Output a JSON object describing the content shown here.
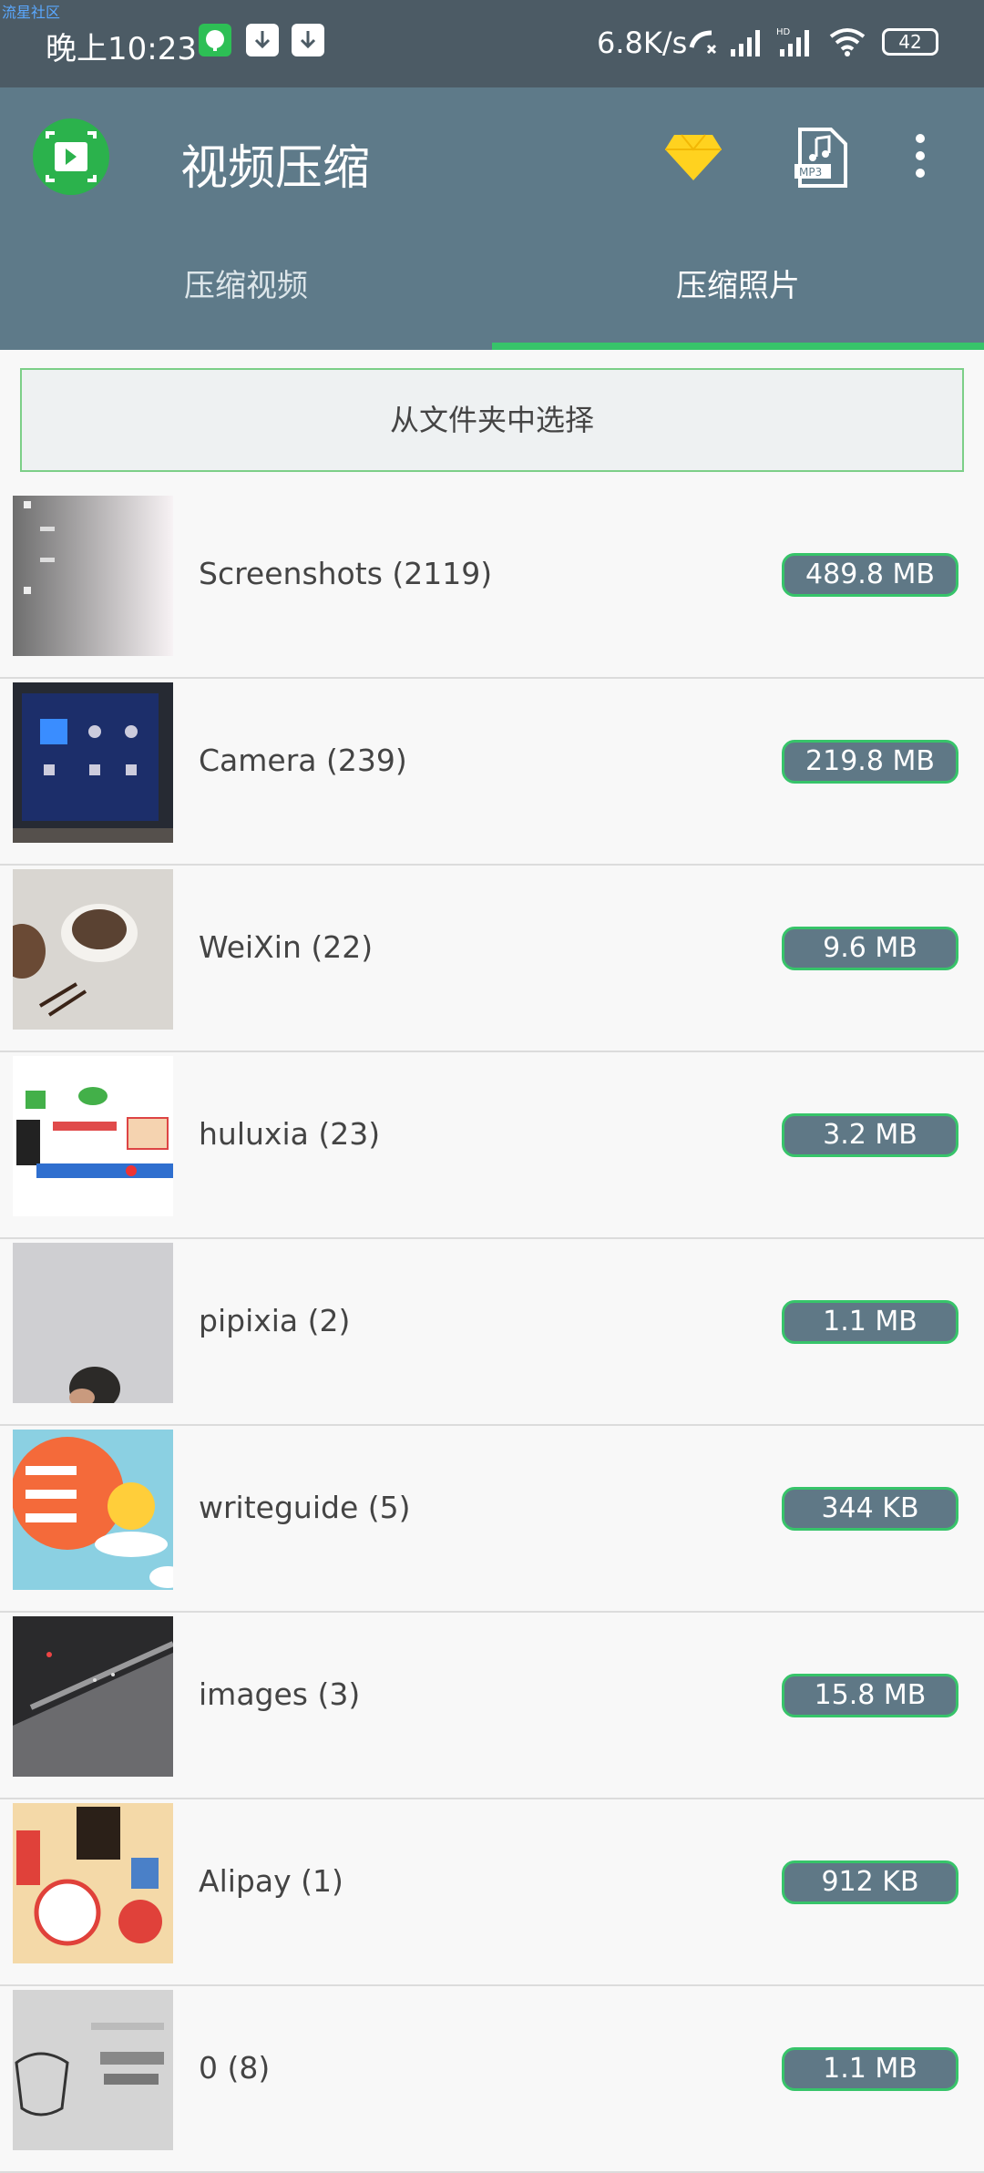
{
  "status_bar": {
    "watermark": "流星社区",
    "time": "晚上10:23",
    "speed": "6.8K/s",
    "battery": "42"
  },
  "app": {
    "title": "视频压缩",
    "icons": [
      "app-logo-icon",
      "premium-diamond-icon",
      "mp3-file-icon",
      "more-vert-icon"
    ]
  },
  "tabs": [
    {
      "label": "压缩视频",
      "selected": false
    },
    {
      "label": "压缩照片",
      "selected": true
    }
  ],
  "select_folder_label": "从文件夹中选择",
  "folders": [
    {
      "name": "Screenshots (2119)",
      "size": "489.8 MB"
    },
    {
      "name": "Camera (239)",
      "size": "219.8 MB"
    },
    {
      "name": "WeiXin (22)",
      "size": "9.6 MB"
    },
    {
      "name": "huluxia (23)",
      "size": "3.2 MB"
    },
    {
      "name": "pipixia (2)",
      "size": "1.1 MB"
    },
    {
      "name": "writeguide (5)",
      "size": "344 KB"
    },
    {
      "name": "images (3)",
      "size": "15.8 MB"
    },
    {
      "name": "Alipay (1)",
      "size": "912 KB"
    },
    {
      "name": "0 (8)",
      "size": "1.1 MB"
    }
  ],
  "colors": {
    "status_bar": "#4c5b65",
    "app_bar": "#5e7a89",
    "accent_green": "#37c46a",
    "size_badge": "#5f7886"
  }
}
